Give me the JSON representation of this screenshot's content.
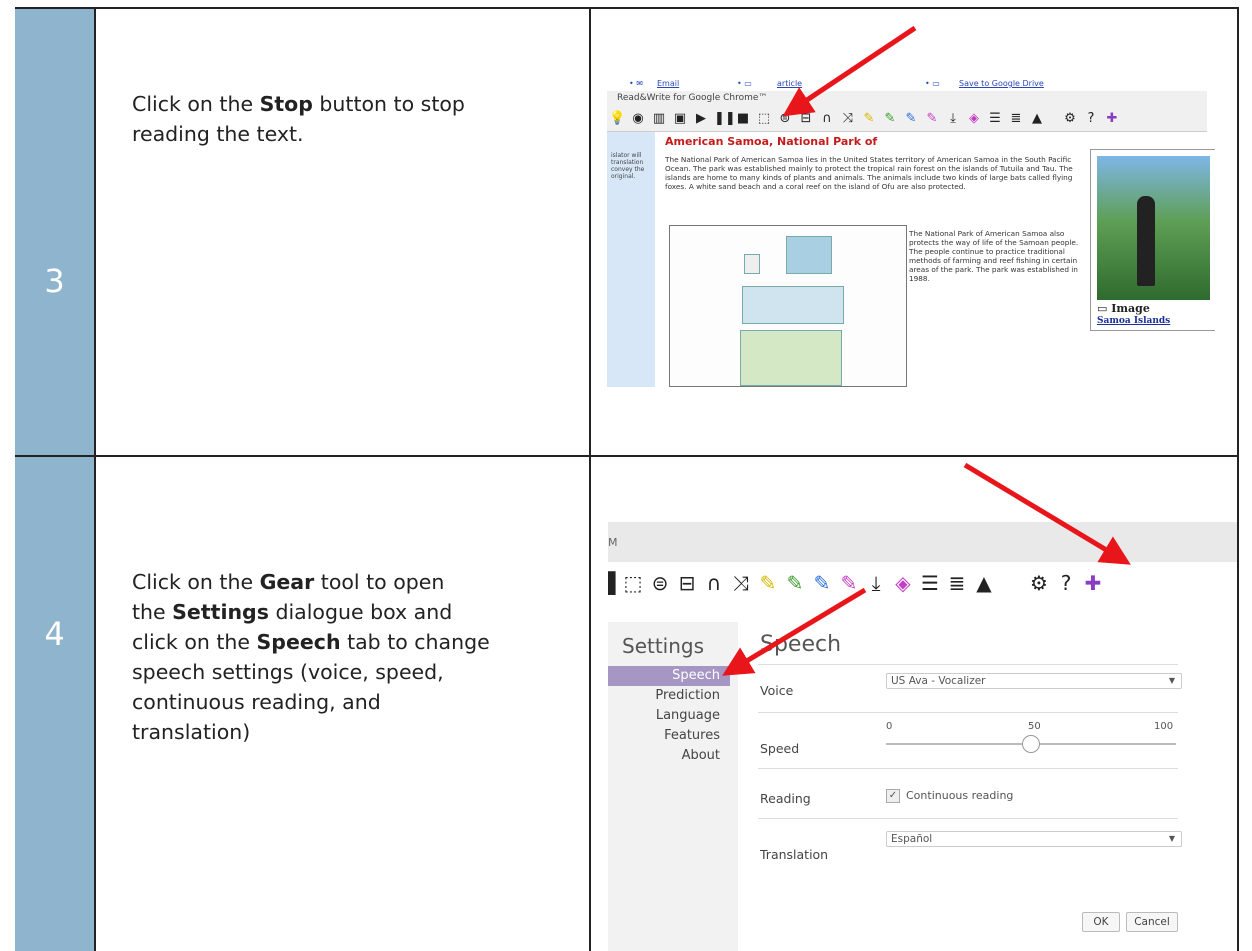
{
  "rows": [
    {
      "number": "3",
      "instruction": {
        "lines": [
          {
            "pre": "Click on the ",
            "kw": "Stop",
            "post": " button to stop"
          },
          {
            "pre": "reading the text.",
            "kw": "",
            "post": ""
          }
        ]
      },
      "screenshot": {
        "links": [
          "Email",
          "article",
          "Save to Google Drive"
        ],
        "toolbar_title": "Read&Write for Google Chrome™",
        "heading": "American Samoa, National Park of",
        "sidebar_text": "islator will translation convey the original.",
        "paragraph1": "The National Park of American Samoa lies in the United States territory of American Samoa in the South Pacific Ocean. The park was established mainly to protect the tropical rain forest on the islands of Tutuila and Tau. The islands are home to many kinds of plants and animals. The animals include two kinds of large bats called flying foxes. A white sand beach and a coral reef on the island of Ofu are also protected.",
        "paragraph2": "The National Park of American Samoa also protects the way of life of the Samoan people. The people continue to practice traditional methods of farming and reef fishing in certain areas of the park. The park was established in 1988.",
        "image_label": "Image",
        "image_link": "Samoa Islands"
      }
    },
    {
      "number": "4",
      "instruction": {
        "lines": [
          {
            "pre": "Click on the ",
            "kw": "Gear",
            "post": " tool to open"
          },
          {
            "pre": "the ",
            "kw": "Settings",
            "post": " dialogue box and"
          },
          {
            "pre": "click on the ",
            "kw": "Speech",
            "post": " tab to change"
          },
          {
            "pre": "speech settings (voice, speed,",
            "kw": "",
            "post": ""
          },
          {
            "pre": "continuous reading, and",
            "kw": "",
            "post": ""
          },
          {
            "pre": "translation)",
            "kw": "",
            "post": ""
          }
        ]
      },
      "screenshot": {
        "top_fragment": "M",
        "settings_title": "Settings",
        "section_title": "Speech",
        "menu": [
          "Speech",
          "Prediction",
          "Language",
          "Features",
          "About"
        ],
        "voice_label": "Voice",
        "voice_value": "US Ava - Vocalizer",
        "speed_label": "Speed",
        "speed_ticks": [
          "0",
          "50",
          "100"
        ],
        "speed_value": 50,
        "reading_label": "Reading",
        "continuous_label": "Continuous reading",
        "translation_label": "Translation",
        "translation_value": "Español",
        "ok_label": "OK",
        "cancel_label": "Cancel"
      }
    }
  ],
  "colors": {
    "number_cell": "#8fb4cd",
    "arrow": "#e8151b",
    "active_tab": "#a696c4",
    "heading_red": "#c51b1b"
  },
  "icons": {
    "toolbar": [
      "lightbulb-icon",
      "dictionary-icon",
      "picture-dictionary-icon",
      "play-icon",
      "pause-icon",
      "stop-icon",
      "screenshot-reader-icon",
      "audio-maker-icon",
      "speech-input-icon",
      "translator-icon",
      "highlighter-icon",
      "settings-gear-icon",
      "help-icon"
    ]
  }
}
